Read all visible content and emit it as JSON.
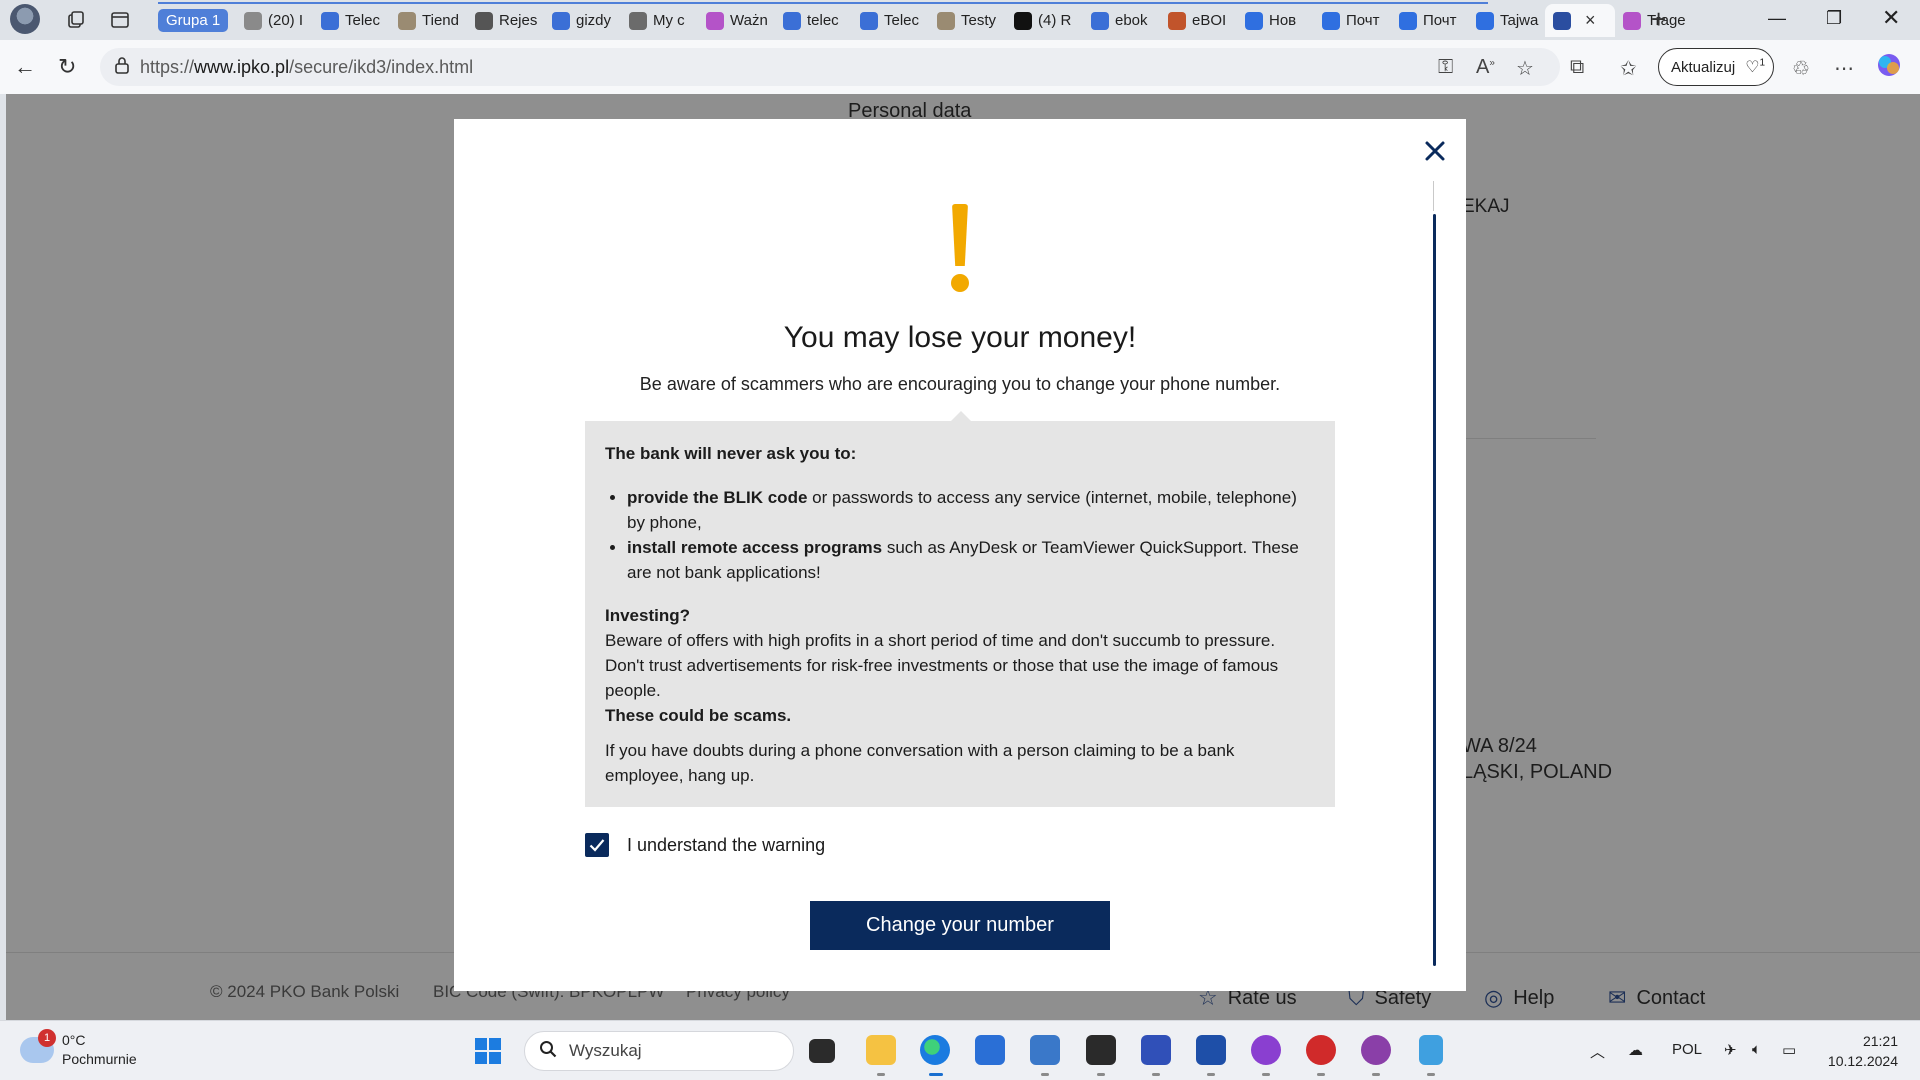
{
  "browser": {
    "tab_group_label": "Grupa 1",
    "tabs": [
      {
        "label": "(20) I",
        "icon": "reddit-icon",
        "color": "#8a8a8a"
      },
      {
        "label": "Telec",
        "icon": "cloud-icon",
        "color": "#3b6fd6"
      },
      {
        "label": "Tiend",
        "icon": "p-icon",
        "color": "#9a8b72"
      },
      {
        "label": "Rejes",
        "icon": "mask-icon",
        "color": "#555555"
      },
      {
        "label": "gizdy",
        "icon": "search-icon",
        "color": "#3b6fd6"
      },
      {
        "label": "My c",
        "icon": "shield-icon",
        "color": "#6b6b6b"
      },
      {
        "label": "Ważn",
        "icon": "butterfly-icon",
        "color": "#b453c8"
      },
      {
        "label": "telec",
        "icon": "search-icon",
        "color": "#3b6fd6"
      },
      {
        "label": "Telec",
        "icon": "cloud-icon",
        "color": "#3b6fd6"
      },
      {
        "label": "Testy",
        "icon": "p-icon",
        "color": "#9a8b72"
      },
      {
        "label": "(4) R",
        "icon": "x-icon",
        "color": "#111111"
      },
      {
        "label": "ebok",
        "icon": "search-icon",
        "color": "#3b6fd6"
      },
      {
        "label": "eBOI",
        "icon": "swirl-icon",
        "color": "#c1542b"
      },
      {
        "label": "Нов",
        "icon": "at-icon",
        "color": "#2f6fe0"
      },
      {
        "label": "Почт",
        "icon": "mail-icon",
        "color": "#2f6fe0"
      },
      {
        "label": "Почт",
        "icon": "mail-icon",
        "color": "#2f6fe0"
      },
      {
        "label": "Tajwa",
        "icon": "outlook-icon",
        "color": "#2f6fe0"
      },
      {
        "label": "",
        "icon": "pko-icon",
        "color": "#2b4ea0",
        "active": true
      },
      {
        "label": "Trage",
        "icon": "butterfly-icon",
        "color": "#b453c8"
      }
    ],
    "url_prefix": "https://",
    "url_domain": "www.ipko.pl",
    "url_path": "/secure/ikd3/index.html",
    "update_button_label": "Aktualizuj",
    "update_badge": "1"
  },
  "page_background": {
    "heading": "Personal data",
    "side_text_1": "EKAJ",
    "address_line_1": "WA 8/24",
    "address_line_2": "LĄSKI, POLAND",
    "footer_copyright": "© 2024 PKO Bank Polski",
    "footer_bic": "BIC Code (Swift): BPKOPLPW",
    "footer_privacy": "Privacy policy",
    "footer_nav": [
      {
        "label": "Rate us",
        "icon": "star-icon"
      },
      {
        "label": "Safety",
        "icon": "shield-check-icon"
      },
      {
        "label": "Help",
        "icon": "lifebuoy-icon"
      },
      {
        "label": "Contact",
        "icon": "envelope-icon"
      }
    ]
  },
  "modal": {
    "title": "You may lose your money!",
    "subtitle": "Be aware of scammers who are encouraging you to change your phone number.",
    "never_ask_heading": "The bank will never ask you to:",
    "bullets": [
      {
        "bold": "provide the BLIK code",
        "rest": " or passwords to access any service (internet, mobile, telephone) by phone,"
      },
      {
        "bold": "install remote access programs",
        "rest": " such as AnyDesk or TeamViewer QuickSupport. These are not bank applications!"
      }
    ],
    "investing_heading": "Investing?",
    "investing_text": "Beware of offers with high profits in a short period of time and don't succumb to pressure. Don't trust advertisements for risk-free investments or those that use the image of famous people.",
    "scams_text": "These could be scams.",
    "doubts_text": "If you have doubts during a phone conversation with a person claiming to be a bank employee, hang up.",
    "checkbox_label": "I understand the warning",
    "checkbox_checked": true,
    "cta_label": "Change your number",
    "accent_color": "#0a2a5c",
    "warning_color": "#f2a900"
  },
  "taskbar": {
    "weather_temp": "0°C",
    "weather_desc": "Pochmurnie",
    "weather_badge": "1",
    "search_placeholder": "Wyszukaj",
    "tray_lang": "POL",
    "time": "21:21",
    "date": "10.12.2024"
  }
}
